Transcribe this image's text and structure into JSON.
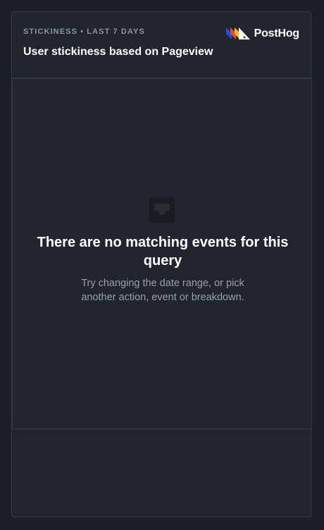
{
  "header": {
    "subtitle": "Stickiness • Last 7 days",
    "title": "User stickiness based on Pageview"
  },
  "brand": {
    "name": "PostHog",
    "logo_icon": "posthog-logo-icon",
    "colors": [
      "#1d4aff",
      "#f54e00",
      "#f9bd2b",
      "#ffffff"
    ]
  },
  "empty_state": {
    "icon": "inbox-icon",
    "title": "There are no matching events for this query",
    "description": "Try changing the date range, or pick another action, event or breakdown."
  },
  "colors": {
    "background": "#1c1f27",
    "card": "#22252d",
    "border": "#353943"
  }
}
